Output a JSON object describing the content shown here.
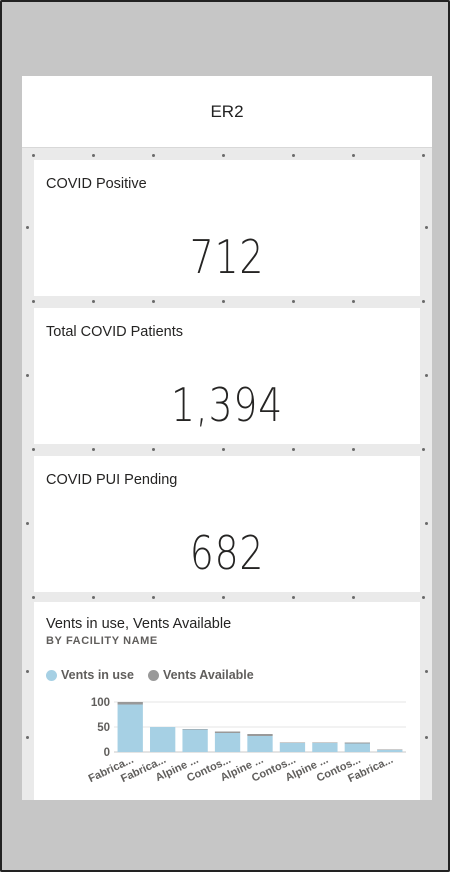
{
  "header": {
    "title": "ER2"
  },
  "cards": [
    {
      "title": "COVID Positive",
      "value": "712"
    },
    {
      "title": "Total COVID Patients",
      "value": "1,394"
    },
    {
      "title": "COVID PUI Pending",
      "value": "682"
    }
  ],
  "chart": {
    "title": "Vents in use, Vents Available",
    "subtitle": "BY FACILITY NAME",
    "legend": [
      {
        "label": "Vents in use",
        "color": "#a6d0e4"
      },
      {
        "label": "Vents Available",
        "color": "#999999"
      }
    ]
  },
  "chart_data": {
    "type": "bar",
    "stacked": true,
    "categories": [
      "Fabrica...",
      "Fabrica...",
      "Alpine ...",
      "Contos...",
      "Alpine ...",
      "Contos...",
      "Alpine ...",
      "Contos...",
      "Fabrica..."
    ],
    "series": [
      {
        "name": "Vents in use",
        "color": "#a6d0e4",
        "values": [
          95,
          50,
          45,
          38,
          32,
          18,
          18,
          17,
          4
        ]
      },
      {
        "name": "Vents Available",
        "color": "#999999",
        "values": [
          5,
          0,
          1,
          3,
          4,
          1,
          1,
          2,
          1
        ]
      }
    ],
    "yticks": [
      0,
      50,
      100
    ],
    "ylim": [
      0,
      100
    ],
    "grid": true,
    "legend_position": "top-left"
  }
}
